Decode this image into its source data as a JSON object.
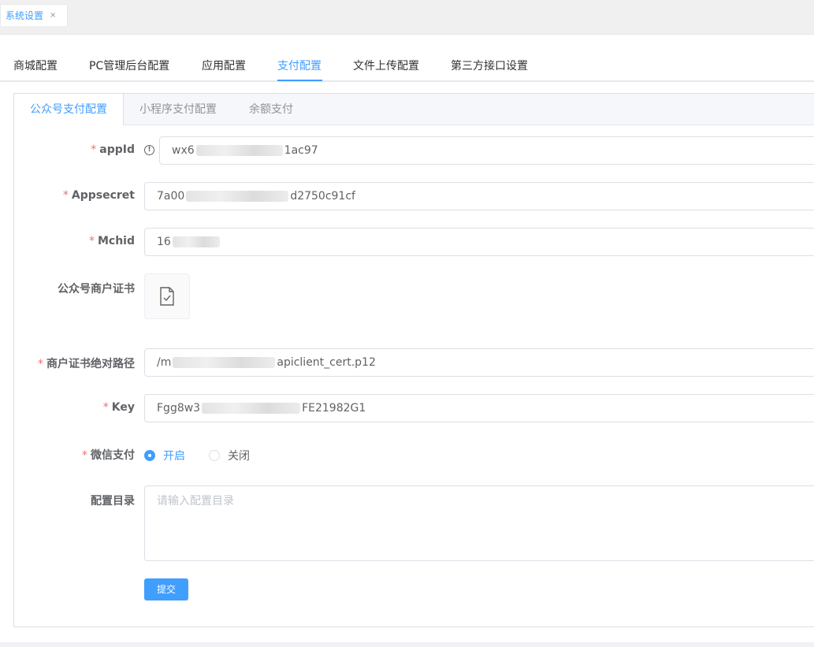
{
  "page_tab": {
    "label": "系统设置",
    "close": "×"
  },
  "main_tabs": [
    "商城配置",
    "PC管理后台配置",
    "应用配置",
    "支付配置",
    "文件上传配置",
    "第三方接口设置"
  ],
  "sub_tabs": [
    "公众号支付配置",
    "小程序支付配置",
    "余额支付"
  ],
  "form": {
    "appid": {
      "label": "appId",
      "prefix": "wx6",
      "suffix": "1ac97"
    },
    "appsecret": {
      "label": "Appsecret",
      "prefix": "7a00",
      "suffix": "d2750c91cf"
    },
    "mchid": {
      "label": "Mchid",
      "prefix": "16",
      "suffix": ""
    },
    "cert": {
      "label": "公众号商户证书"
    },
    "cert_path": {
      "label": "商户证书绝对路径",
      "prefix": "/m",
      "suffix": "apiclient_cert.p12"
    },
    "key": {
      "label": "Key",
      "prefix": "Fgg8w3",
      "suffix": "FE21982G1"
    },
    "wechat_pay": {
      "label": "微信支付",
      "on": "开启",
      "off": "关闭"
    },
    "config_dir": {
      "label": "配置目录",
      "placeholder": "请输入配置目录"
    },
    "required_mark": "*"
  },
  "submit_label": "提交",
  "colors": {
    "primary": "#409eff",
    "required": "#f56c6c"
  },
  "icons": {
    "info": "info-icon",
    "certificate": "file-check-icon"
  }
}
